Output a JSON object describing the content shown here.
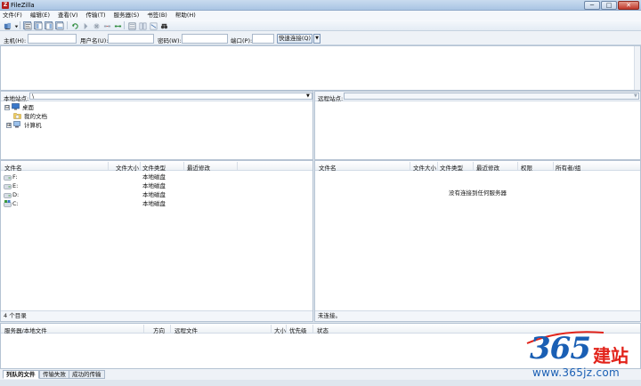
{
  "window": {
    "title": "FileZilla",
    "app_icon": "filezilla-logo-icon",
    "buttons": {
      "minimize": "─",
      "maximize": "□",
      "close": "✕"
    }
  },
  "menu": [
    "文件(F)",
    "编辑(E)",
    "查看(V)",
    "传输(T)",
    "服务器(S)",
    "书签(B)",
    "帮助(H)"
  ],
  "toolbar": {
    "icons": [
      "site-manager-icon",
      "site-manager-dropdown-icon",
      "toggle-message-log-icon",
      "toggle-local-tree-icon",
      "toggle-remote-tree-icon",
      "toggle-queue-icon",
      "refresh-icon",
      "process-queue-icon",
      "cancel-icon",
      "disconnect-icon",
      "reconnect-icon",
      "directory-listing-filter-icon",
      "sync-browsing-icon",
      "dir-compare-icon",
      "search-icon"
    ]
  },
  "quickconnect": {
    "host_label": "主机(H):",
    "host_value": "",
    "user_label": "用户名(U):",
    "user_value": "",
    "pass_label": "密码(W):",
    "pass_value": "",
    "port_label": "端口(P):",
    "port_value": "",
    "button_label": "快速连接(Q)",
    "dropdown": "▼"
  },
  "local": {
    "site_label": "本地站点:",
    "site_value": "\\",
    "dropdown": "▼",
    "tree": [
      {
        "label": "桌面",
        "icon": "desktop-icon",
        "expander": "⊟",
        "level": 0
      },
      {
        "label": "我的文档",
        "icon": "documents-folder-icon",
        "expander": "",
        "level": 1
      },
      {
        "label": "计算机",
        "icon": "computer-icon",
        "expander": "⊞",
        "level": 1
      }
    ],
    "columns": [
      "文件名",
      "文件大小",
      "文件类型",
      "最近修改"
    ],
    "files": [
      {
        "name": "F:",
        "size": "",
        "type": "本地磁盘",
        "icon": "drive-icon"
      },
      {
        "name": "E:",
        "size": "",
        "type": "本地磁盘",
        "icon": "drive-icon"
      },
      {
        "name": "D:",
        "size": "",
        "type": "本地磁盘",
        "icon": "drive-icon"
      },
      {
        "name": "C:",
        "size": "",
        "type": "本地磁盘",
        "icon": "system-drive-icon"
      }
    ],
    "status": "4 个目录"
  },
  "remote": {
    "site_label": "远程站点:",
    "site_value": "",
    "dropdown": "▼",
    "columns": [
      "文件名",
      "文件大小",
      "文件类型",
      "最近修改",
      "权限",
      "所有者/组"
    ],
    "empty_message": "没有连接到任何服务器",
    "status": "未连接。"
  },
  "queue": {
    "columns": [
      "服务器/本地文件",
      "方向",
      "远程文件",
      "大小",
      "优先级",
      "状态"
    ],
    "tabs": [
      "列队的文件",
      "传输失败",
      "成功的传输"
    ]
  },
  "watermark": {
    "brand": "365",
    "brand_cn": "建站",
    "url": "www.365jz.com"
  }
}
